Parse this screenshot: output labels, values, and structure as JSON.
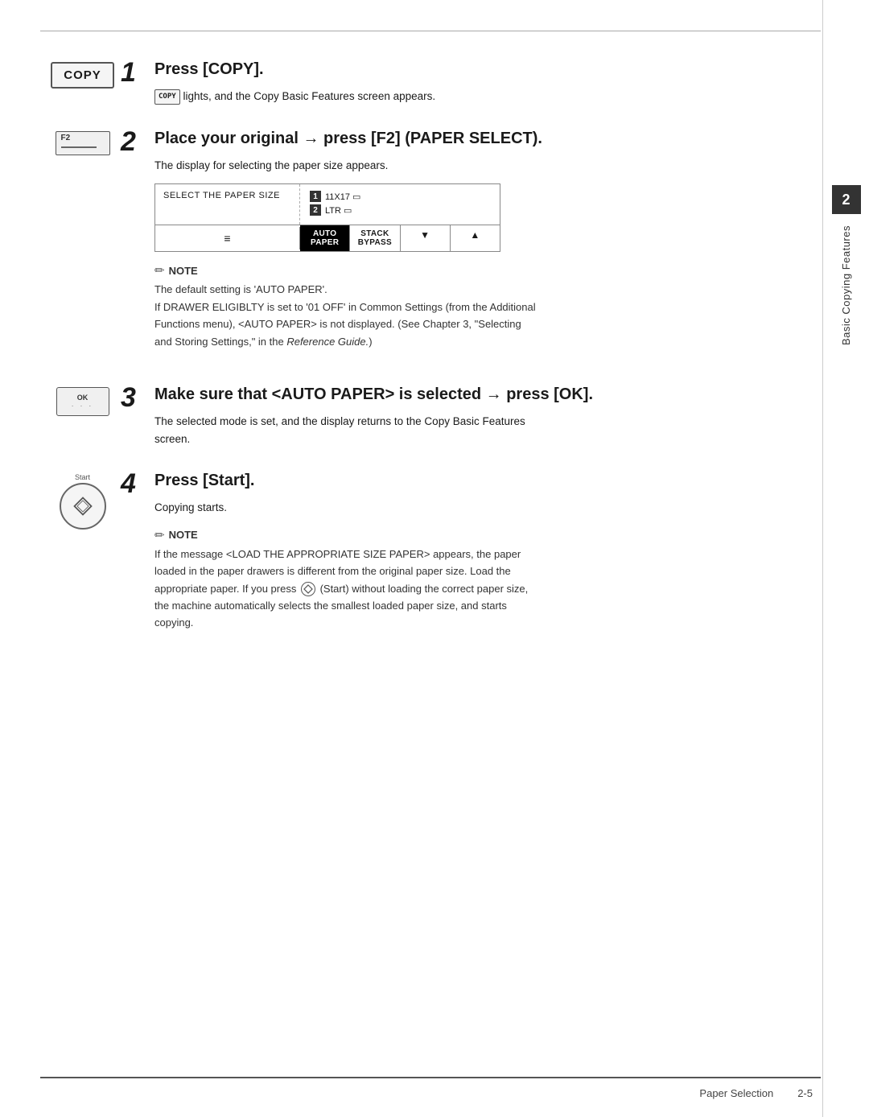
{
  "page": {
    "top_border": true,
    "bottom_border": true
  },
  "sidebar": {
    "chapter_number": "2",
    "chapter_title": "Basic Copying Features"
  },
  "footer": {
    "section_label": "Paper Selection",
    "page_number": "2-5"
  },
  "steps": [
    {
      "number": "1",
      "heading": "Press [COPY].",
      "icon_type": "copy-button",
      "icon_label": "COPY",
      "body_lines": [
        "lights, and the Copy Basic Features screen appears."
      ],
      "inline_badge": "COPY"
    },
    {
      "number": "2",
      "heading": "Place your original → press [F2] (PAPER SELECT).",
      "icon_type": "f2-button",
      "icon_label": "F2",
      "body_lines": [
        "The display for selecting the paper size appears."
      ],
      "has_lcd": true
    },
    {
      "number": "3",
      "heading": "Make sure that <AUTO PAPER> is selected → press [OK].",
      "icon_type": "ok-button",
      "icon_label": "OK",
      "body_lines": [
        "The selected mode is set, and the display returns to the Copy Basic Features",
        "screen."
      ]
    },
    {
      "number": "4",
      "heading": "Press [Start].",
      "icon_type": "start-button",
      "icon_label": "Start",
      "body_lines": [
        "Copying starts."
      ],
      "has_note2": true
    }
  ],
  "lcd": {
    "left_text": "SELECT THE PAPER SIZE",
    "items": [
      {
        "number": "1",
        "text": "11X17"
      },
      {
        "number": "2",
        "text": "LTR"
      }
    ],
    "sheet_icon": "≡",
    "buttons": [
      "AUTO PAPER",
      "STACK BYPASS",
      "▼",
      "▲"
    ]
  },
  "note1": {
    "title": "NOTE",
    "lines": [
      "The default setting is 'AUTO PAPER'.",
      "If DRAWER ELIGIBLTY is set to '01 OFF' in Common Settings (from the Additional",
      "Functions menu), <AUTO PAPER> is not displayed. (See Chapter 3, \"Selecting",
      "and Storing Settings,\" in the Reference Guide.)"
    ]
  },
  "note2": {
    "title": "NOTE",
    "lines": [
      "If the message <LOAD THE APPROPRIATE SIZE PAPER> appears, the paper",
      "loaded in the paper drawers is different from the original paper size. Load the",
      "appropriate paper. If you press  (Start) without loading the correct paper size,",
      "the machine automatically selects the smallest loaded paper size, and starts",
      "copying."
    ]
  }
}
